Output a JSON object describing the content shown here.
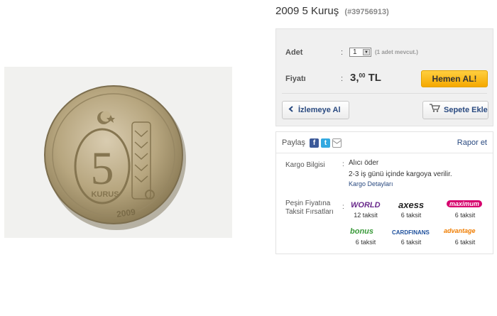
{
  "product": {
    "title": "2009 5 Kuruş",
    "code": "(#39756913)"
  },
  "coin_image": {
    "year": "2009",
    "denomination": "5",
    "unit": "KURUŞ"
  },
  "purchase": {
    "qty_label": "Adet",
    "qty_value": "1",
    "stock_note": "(1 adet mevcut.)",
    "price_label": "Fiyatı",
    "price_main": "3,",
    "price_decimals": "00",
    "currency": "TL",
    "buy_label": "Hemen AL!",
    "watch_label": "İzlemeye Al",
    "cart_label": "Sepete Ekle",
    "colon": ":"
  },
  "info": {
    "share_label": "Paylaş",
    "report_label": "Rapor et",
    "shipping_label": "Kargo Bilgisi",
    "shipping_payer": "Alıcı öder",
    "shipping_time": "2-3 iş günü içinde kargoya verilir.",
    "shipping_link": "Kargo Detayları",
    "installment_label_1": "Peşin Fiyatına",
    "installment_label_2": "Taksit Fırsatları",
    "cards": [
      {
        "name": "WORLD",
        "installments": "12 taksit",
        "color": "#6a2a8c"
      },
      {
        "name": "axess",
        "installments": "6 taksit",
        "color": "#222222"
      },
      {
        "name": "maximum",
        "installments": "6 taksit",
        "color": "#d6006e"
      },
      {
        "name": "bonus",
        "installments": "6 taksit",
        "color": "#3a9a3a"
      },
      {
        "name": "CARDFINANS",
        "installments": "6 taksit",
        "color": "#1d4f9c"
      },
      {
        "name": "advantage",
        "installments": "6 taksit",
        "color": "#f07d00"
      }
    ]
  },
  "colors": {
    "buy_button": "#f5a800",
    "link": "#2a4a80",
    "panel_bg": "#f0f0f0"
  }
}
